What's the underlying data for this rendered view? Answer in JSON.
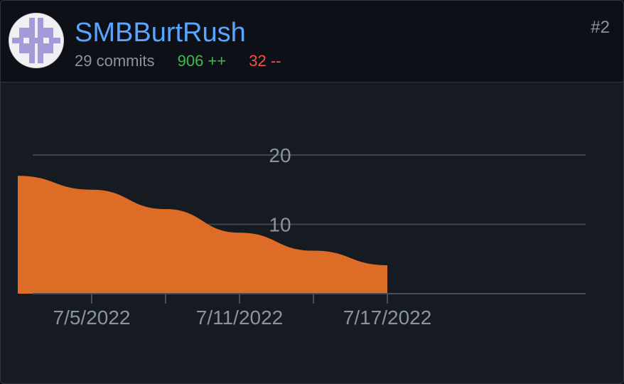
{
  "contributor": {
    "username": "SMBBurtRush",
    "commits_text": "29 commits",
    "additions_text": "906 ++",
    "deletions_text": "32 --",
    "rank": "#2",
    "avatar_icon": "identicon-avatar"
  },
  "colors": {
    "link": "#58a6ff",
    "additions": "#3fb950",
    "deletions": "#f85149",
    "area_fill": "#dd6c27"
  },
  "chart_data": {
    "type": "area",
    "x": [
      "7/2/2022",
      "7/5/2022",
      "7/8/2022",
      "7/11/2022",
      "7/14/2022",
      "7/17/2022"
    ],
    "values": [
      17,
      15,
      12.2,
      8.8,
      6.2,
      4.1
    ],
    "x_tick_labels": [
      "7/5/2022",
      "7/11/2022",
      "7/17/2022"
    ],
    "y_tick_labels": [
      "10",
      "20"
    ],
    "ylim": [
      0,
      20
    ],
    "grid": true,
    "series": [
      {
        "values": [
          17,
          15,
          12.2,
          8.8,
          6.2,
          4.1
        ]
      }
    ]
  }
}
